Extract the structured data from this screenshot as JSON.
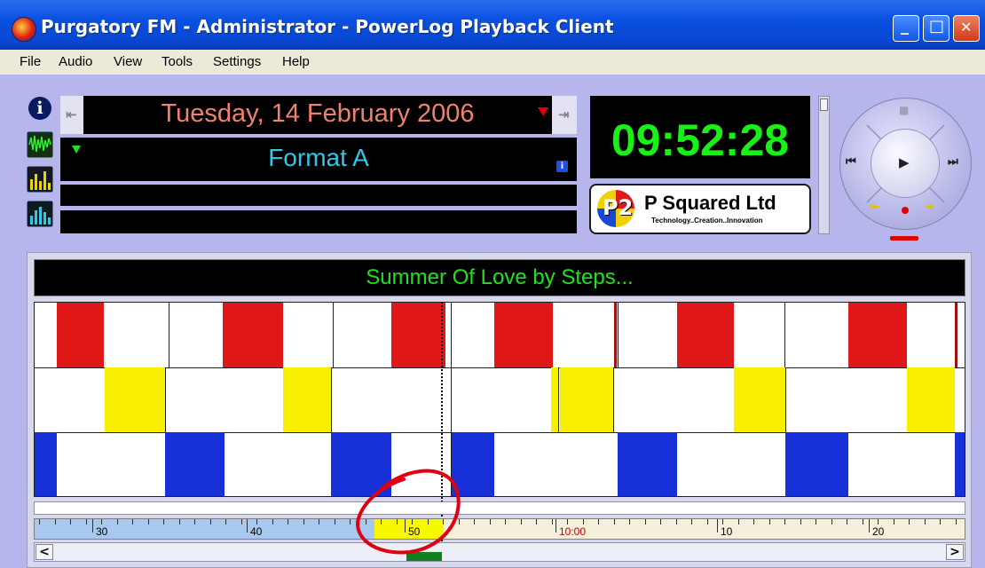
{
  "window": {
    "title": "Purgatory FM - Administrator - PowerLog Playback Client",
    "controls": {
      "minimize": "_",
      "maximize": "□",
      "close": "✕"
    }
  },
  "menu": [
    "File",
    "Audio",
    "View",
    "Tools",
    "Settings",
    "Help"
  ],
  "sidebar": {
    "info_glyph": "i",
    "icons": [
      "info-icon",
      "waveform-icon",
      "meter-icon",
      "spectrum-icon"
    ]
  },
  "date_panel": {
    "date": "Tuesday, 14 February 2006",
    "prev_glyph": "⇤",
    "next_glyph": "⇥"
  },
  "format_panel": {
    "format": "Format A",
    "info_glyph": "i"
  },
  "clock": {
    "time": "09:52:28"
  },
  "logo": {
    "mark": "P2",
    "name": "P Squared Ltd",
    "tagline": "Technology..Creation..Innovation"
  },
  "transport": {
    "stop": "■",
    "play": "▶",
    "prev": "⏮",
    "next": "⏭",
    "seg_left": "⇤",
    "seg_right": "⇥"
  },
  "now_playing": "Summer Of Love by Steps...",
  "timeline": {
    "labels": [
      "30",
      "40",
      "50",
      "10:00",
      "10",
      "20"
    ],
    "current_label": "50",
    "hour_label": "10:00"
  },
  "scrollbar": {
    "left": "<",
    "right": ">"
  },
  "colors": {
    "title_blue": "#0846d0",
    "lcd_bg": "#000000",
    "date_red": "#f08070",
    "format_cyan": "#30c8e8",
    "clock_green": "#18f018",
    "song_green": "#20e020",
    "log_red": "#e01818",
    "log_yellow": "#f8f000",
    "log_blue": "#1830d8"
  }
}
